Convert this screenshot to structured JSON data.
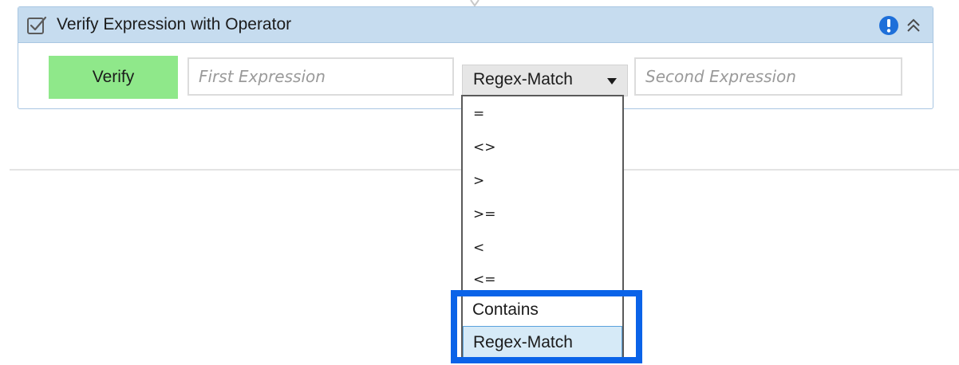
{
  "activity": {
    "title": "Verify Expression with Operator",
    "verify_label": "Verify",
    "first_expression": {
      "value": "",
      "placeholder": "First Expression"
    },
    "operator": {
      "selected": "Regex-Match"
    },
    "second_expression": {
      "value": "",
      "placeholder": "Second Expression"
    }
  },
  "dropdown": {
    "options": [
      "=",
      "<>",
      ">",
      ">=",
      "<",
      "<=",
      "Contains",
      "Regex-Match"
    ],
    "selected_index": 7,
    "highlighted_options": [
      "Contains",
      "Regex-Match"
    ]
  },
  "icons": {
    "header_check": "checkbox-icon",
    "info": "info-icon",
    "collapse": "double-chevron-up-icon",
    "dropdown_arrow": "caret-down-icon"
  },
  "colors": {
    "header_bg": "#c6dcef",
    "verify_bg": "#8fe88a",
    "selected_option_bg": "#d6eaf7",
    "highlight_border": "#0a63e8",
    "info_blue": "#1e6fd9"
  }
}
